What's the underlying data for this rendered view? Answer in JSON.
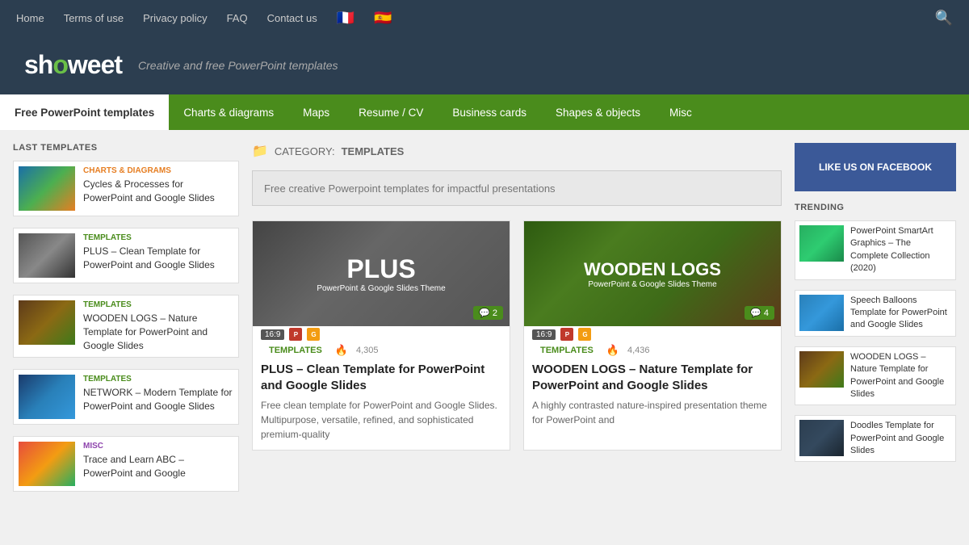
{
  "top_nav": {
    "links": [
      "Home",
      "Terms of use",
      "Privacy policy",
      "FAQ",
      "Contact us"
    ],
    "flags": [
      "🇫🇷",
      "🇪🇸"
    ]
  },
  "header": {
    "logo": "sh",
    "logo_o": "o",
    "logo_rest": "weet",
    "tagline": "Creative and free PowerPoint templates"
  },
  "main_nav": {
    "items": [
      {
        "label": "Free PowerPoint templates",
        "active": true
      },
      {
        "label": "Charts & diagrams",
        "active": false
      },
      {
        "label": "Maps",
        "active": false
      },
      {
        "label": "Resume / CV",
        "active": false
      },
      {
        "label": "Business cards",
        "active": false
      },
      {
        "label": "Shapes & objects",
        "active": false
      },
      {
        "label": "Misc",
        "active": false
      }
    ]
  },
  "sidebar_left": {
    "section_title": "LAST TEMPLATES",
    "items": [
      {
        "id": "cycles",
        "cat": "CHARTS & DIAGRAMS",
        "cat_class": "tag-charts",
        "thumb_class": "thumb-cycles",
        "title": "Cycles & Processes for PowerPoint and Google Slides"
      },
      {
        "id": "plus",
        "cat": "TEMPLATES",
        "cat_class": "tag-templates",
        "thumb_class": "thumb-plus",
        "title": "PLUS – Clean Template for PowerPoint and Google Slides"
      },
      {
        "id": "wooden",
        "cat": "TEMPLATES",
        "cat_class": "tag-templates",
        "thumb_class": "thumb-wooden",
        "title": "WOODEN LOGS – Nature Template for PowerPoint and Google Slides"
      },
      {
        "id": "network",
        "cat": "TEMPLATES",
        "cat_class": "tag-templates",
        "thumb_class": "thumb-network",
        "title": "NETWORK – Modern Template for PowerPoint and Google Slides"
      },
      {
        "id": "trace",
        "cat": "MISC",
        "cat_class": "tag-misc",
        "thumb_class": "thumb-trace",
        "title": "Trace and Learn ABC – PowerPoint and Google"
      }
    ]
  },
  "main": {
    "category_label": "CATEGORY:",
    "category_name": "TEMPLATES",
    "search_placeholder": "Free creative Powerpoint templates for impactful presentations",
    "cards": [
      {
        "id": "plus-card",
        "thumb_class": "card-thumb-plus",
        "big_label": "PLUS",
        "sub_label": "PowerPoint & Google Slides Theme",
        "comments": 2,
        "ratio": "16:9",
        "cat": "TEMPLATES",
        "views": "4,305",
        "title": "PLUS – Clean Template for PowerPoint and Google Slides",
        "desc": "Free clean template for PowerPoint and Google Slides. Multipurpose, versatile, refined, and sophisticated premium-quality"
      },
      {
        "id": "wooden-card",
        "thumb_class": "card-thumb-wooden",
        "big_label": "WOODEN LOGS",
        "sub_label": "PowerPoint & Google Slides Theme",
        "comments": 4,
        "ratio": "16:9",
        "cat": "TEMPLATES",
        "views": "4,436",
        "title": "WOODEN LOGS – Nature Template for PowerPoint and Google Slides",
        "desc": "A highly contrasted nature-inspired presentation theme for PowerPoint and"
      }
    ]
  },
  "sidebar_right": {
    "fb_label": "LIKE US ON FACEBOOK",
    "trending_title": "TRENDING",
    "items": [
      {
        "thumb_class": "trend-thumb-smartart",
        "title": "PowerPoint SmartArt Graphics – The Complete Collection (2020)"
      },
      {
        "thumb_class": "trend-thumb-speech",
        "title": "Speech Balloons Template for PowerPoint and Google Slides"
      },
      {
        "thumb_class": "trend-thumb-wooden2",
        "title": "WOODEN LOGS – Nature Template for PowerPoint and Google Slides"
      },
      {
        "thumb_class": "trend-thumb-doodles",
        "title": "Doodles Template for PowerPoint and Google Slides"
      }
    ]
  }
}
